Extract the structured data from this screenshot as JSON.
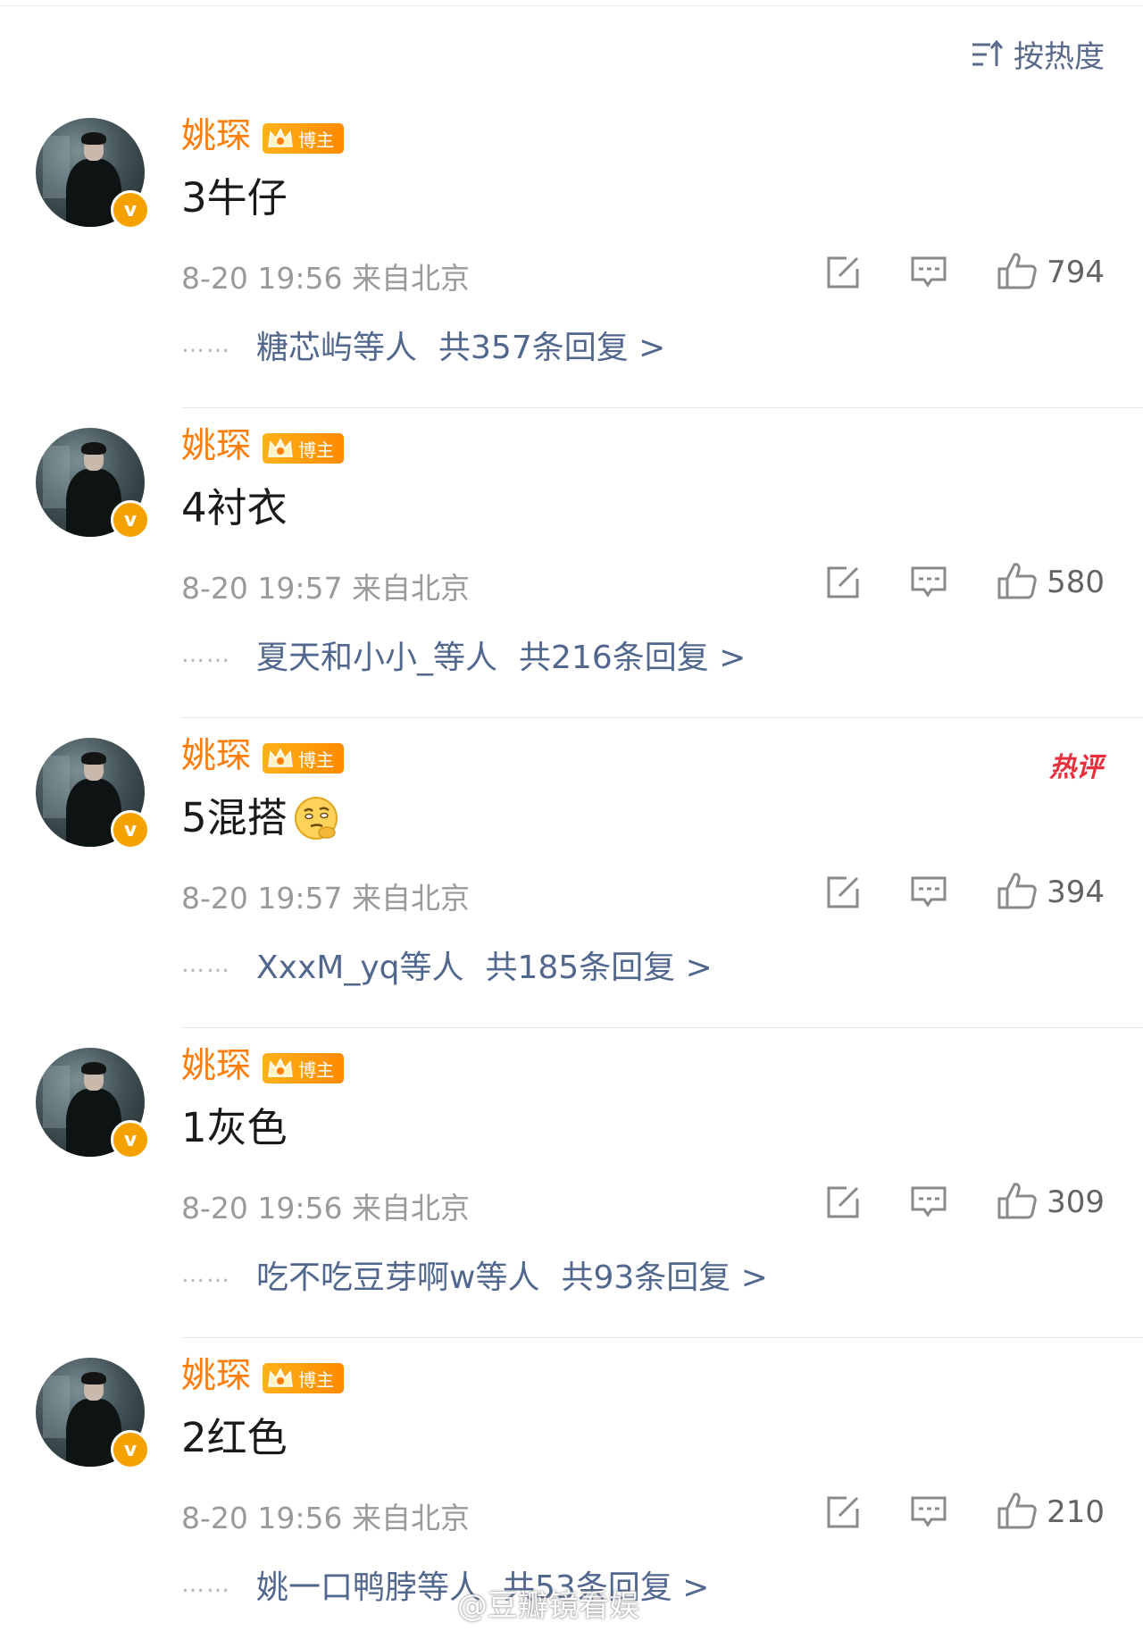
{
  "sort": {
    "label": "按热度",
    "icon": "sort-icon"
  },
  "comments": [
    {
      "author": "姚琛",
      "tag": "博主",
      "text": "3牛仔",
      "time": "8-20 19:56 来自北京",
      "likes": "794",
      "reply_users": "糖芯屿等人",
      "reply_total": "共357条回复 >"
    },
    {
      "author": "姚琛",
      "tag": "博主",
      "text": "4衬衣",
      "time": "8-20 19:57 来自北京",
      "likes": "580",
      "reply_users": "夏天和小小_等人",
      "reply_total": "共216条回复 >"
    },
    {
      "author": "姚琛",
      "tag": "博主",
      "text": "5混搭",
      "time": "8-20 19:57 来自北京",
      "likes": "394",
      "reply_users": "XxxM_yq等人",
      "reply_total": "共185条回复 >",
      "hot_badge": "热评"
    },
    {
      "author": "姚琛",
      "tag": "博主",
      "text": "1灰色",
      "time": "8-20 19:56 来自北京",
      "likes": "309",
      "reply_users": "吃不吃豆芽啊w等人",
      "reply_total": "共93条回复 >"
    },
    {
      "author": "姚琛",
      "tag": "博主",
      "text": "2红色",
      "time": "8-20 19:56 来自北京",
      "likes": "210",
      "reply_users": "姚一口鸭脖等人",
      "reply_total": "共53条回复 >"
    }
  ],
  "reply_prefix": "……",
  "watermark": "@豆瓣镜看娱",
  "colors": {
    "author": "#ff7d0a",
    "link": "#52678e",
    "meta": "#9a9a9a",
    "tag": "#ff8a00",
    "hot": "#e8303d"
  }
}
